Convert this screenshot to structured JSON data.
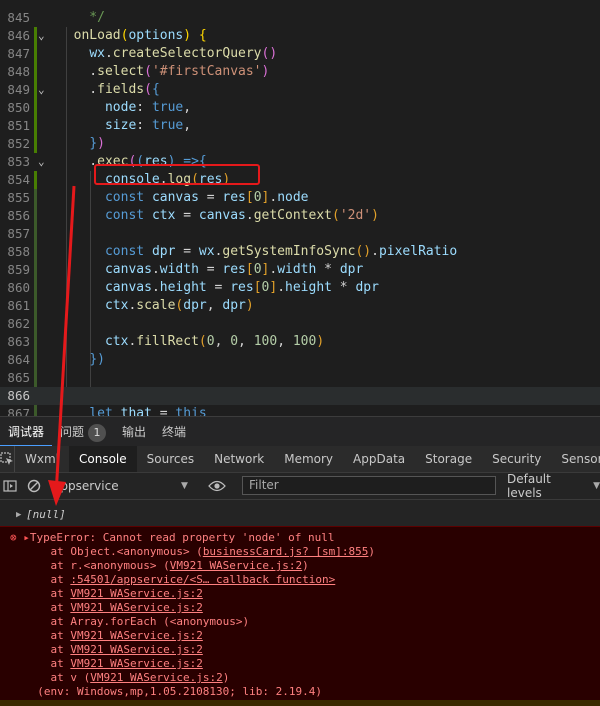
{
  "editor": {
    "lines": [
      {
        "num": "845",
        "segs": [
          {
            "t": "    */",
            "c": "c"
          }
        ]
      },
      {
        "num": "846",
        "fold": true,
        "segs": [
          {
            "t": "  ",
            "c": "pl"
          },
          {
            "t": "onLoad",
            "c": "f"
          },
          {
            "t": "(",
            "c": "y"
          },
          {
            "t": "options",
            "c": "p"
          },
          {
            "t": ") ",
            "c": "y"
          },
          {
            "t": "{",
            "c": "y"
          }
        ]
      },
      {
        "num": "847",
        "segs": [
          {
            "t": "    ",
            "c": "pl"
          },
          {
            "t": "wx",
            "c": "p"
          },
          {
            "t": ".",
            "c": "pl"
          },
          {
            "t": "createSelectorQuery",
            "c": "f"
          },
          {
            "t": "()",
            "c": "pu"
          }
        ]
      },
      {
        "num": "848",
        "segs": [
          {
            "t": "    .",
            "c": "pl"
          },
          {
            "t": "select",
            "c": "f"
          },
          {
            "t": "(",
            "c": "pu"
          },
          {
            "t": "'#firstCanvas'",
            "c": "s"
          },
          {
            "t": ")",
            "c": "pu"
          }
        ]
      },
      {
        "num": "849",
        "fold": true,
        "segs": [
          {
            "t": "    .",
            "c": "pl"
          },
          {
            "t": "fields",
            "c": "f"
          },
          {
            "t": "(",
            "c": "pu"
          },
          {
            "t": "{",
            "c": "v"
          }
        ]
      },
      {
        "num": "850",
        "segs": [
          {
            "t": "      ",
            "c": "pl"
          },
          {
            "t": "node",
            "c": "p"
          },
          {
            "t": ": ",
            "c": "pl"
          },
          {
            "t": "true",
            "c": "v"
          },
          {
            "t": ",",
            "c": "pl"
          }
        ]
      },
      {
        "num": "851",
        "segs": [
          {
            "t": "      ",
            "c": "pl"
          },
          {
            "t": "size",
            "c": "p"
          },
          {
            "t": ": ",
            "c": "pl"
          },
          {
            "t": "true",
            "c": "v"
          },
          {
            "t": ",",
            "c": "pl"
          }
        ]
      },
      {
        "num": "852",
        "segs": [
          {
            "t": "    ",
            "c": "pl"
          },
          {
            "t": "}",
            "c": "v"
          },
          {
            "t": ")",
            "c": "pu"
          }
        ]
      },
      {
        "num": "853",
        "fold": true,
        "segs": [
          {
            "t": "    .",
            "c": "pl"
          },
          {
            "t": "exec",
            "c": "f"
          },
          {
            "t": "(",
            "c": "pu"
          },
          {
            "t": "(",
            "c": "v"
          },
          {
            "t": "res",
            "c": "p"
          },
          {
            "t": ")",
            "c": "v"
          },
          {
            "t": " ",
            "c": "pl"
          },
          {
            "t": "=>",
            "c": "v"
          },
          {
            "t": "{",
            "c": "v"
          }
        ]
      },
      {
        "num": "854",
        "segs": [
          {
            "t": "      ",
            "c": "pl"
          },
          {
            "t": "console",
            "c": "p"
          },
          {
            "t": ".",
            "c": "pl"
          },
          {
            "t": "log",
            "c": "f"
          },
          {
            "t": "(",
            "c": "o"
          },
          {
            "t": "res",
            "c": "p"
          },
          {
            "t": ")",
            "c": "o"
          }
        ]
      },
      {
        "num": "855",
        "segs": [
          {
            "t": "      ",
            "c": "pl"
          },
          {
            "t": "const",
            "c": "v"
          },
          {
            "t": " ",
            "c": "pl"
          },
          {
            "t": "canvas",
            "c": "p"
          },
          {
            "t": " = ",
            "c": "pl"
          },
          {
            "t": "res",
            "c": "p"
          },
          {
            "t": "[",
            "c": "o"
          },
          {
            "t": "0",
            "c": "n"
          },
          {
            "t": "]",
            "c": "o"
          },
          {
            "t": ".",
            "c": "pl"
          },
          {
            "t": "node",
            "c": "p"
          }
        ]
      },
      {
        "num": "856",
        "segs": [
          {
            "t": "      ",
            "c": "pl"
          },
          {
            "t": "const",
            "c": "v"
          },
          {
            "t": " ",
            "c": "pl"
          },
          {
            "t": "ctx",
            "c": "p"
          },
          {
            "t": " = ",
            "c": "pl"
          },
          {
            "t": "canvas",
            "c": "p"
          },
          {
            "t": ".",
            "c": "pl"
          },
          {
            "t": "getContext",
            "c": "f"
          },
          {
            "t": "(",
            "c": "o"
          },
          {
            "t": "'2d'",
            "c": "s"
          },
          {
            "t": ")",
            "c": "o"
          }
        ]
      },
      {
        "num": "857",
        "segs": []
      },
      {
        "num": "858",
        "segs": [
          {
            "t": "      ",
            "c": "pl"
          },
          {
            "t": "const",
            "c": "v"
          },
          {
            "t": " ",
            "c": "pl"
          },
          {
            "t": "dpr",
            "c": "p"
          },
          {
            "t": " = ",
            "c": "pl"
          },
          {
            "t": "wx",
            "c": "p"
          },
          {
            "t": ".",
            "c": "pl"
          },
          {
            "t": "getSystemInfoSync",
            "c": "f"
          },
          {
            "t": "()",
            "c": "o"
          },
          {
            "t": ".",
            "c": "pl"
          },
          {
            "t": "pixelRatio",
            "c": "p"
          }
        ]
      },
      {
        "num": "859",
        "segs": [
          {
            "t": "      ",
            "c": "pl"
          },
          {
            "t": "canvas",
            "c": "p"
          },
          {
            "t": ".",
            "c": "pl"
          },
          {
            "t": "width",
            "c": "p"
          },
          {
            "t": " = ",
            "c": "pl"
          },
          {
            "t": "res",
            "c": "p"
          },
          {
            "t": "[",
            "c": "o"
          },
          {
            "t": "0",
            "c": "n"
          },
          {
            "t": "]",
            "c": "o"
          },
          {
            "t": ".",
            "c": "pl"
          },
          {
            "t": "width",
            "c": "p"
          },
          {
            "t": " * ",
            "c": "pl"
          },
          {
            "t": "dpr",
            "c": "p"
          }
        ]
      },
      {
        "num": "860",
        "segs": [
          {
            "t": "      ",
            "c": "pl"
          },
          {
            "t": "canvas",
            "c": "p"
          },
          {
            "t": ".",
            "c": "pl"
          },
          {
            "t": "height",
            "c": "p"
          },
          {
            "t": " = ",
            "c": "pl"
          },
          {
            "t": "res",
            "c": "p"
          },
          {
            "t": "[",
            "c": "o"
          },
          {
            "t": "0",
            "c": "n"
          },
          {
            "t": "]",
            "c": "o"
          },
          {
            "t": ".",
            "c": "pl"
          },
          {
            "t": "height",
            "c": "p"
          },
          {
            "t": " * ",
            "c": "pl"
          },
          {
            "t": "dpr",
            "c": "p"
          }
        ]
      },
      {
        "num": "861",
        "segs": [
          {
            "t": "      ",
            "c": "pl"
          },
          {
            "t": "ctx",
            "c": "p"
          },
          {
            "t": ".",
            "c": "pl"
          },
          {
            "t": "scale",
            "c": "f"
          },
          {
            "t": "(",
            "c": "o"
          },
          {
            "t": "dpr",
            "c": "p"
          },
          {
            "t": ", ",
            "c": "pl"
          },
          {
            "t": "dpr",
            "c": "p"
          },
          {
            "t": ")",
            "c": "o"
          }
        ]
      },
      {
        "num": "862",
        "segs": []
      },
      {
        "num": "863",
        "segs": [
          {
            "t": "      ",
            "c": "pl"
          },
          {
            "t": "ctx",
            "c": "p"
          },
          {
            "t": ".",
            "c": "pl"
          },
          {
            "t": "fillRect",
            "c": "f"
          },
          {
            "t": "(",
            "c": "o"
          },
          {
            "t": "0",
            "c": "n"
          },
          {
            "t": ", ",
            "c": "pl"
          },
          {
            "t": "0",
            "c": "n"
          },
          {
            "t": ", ",
            "c": "pl"
          },
          {
            "t": "100",
            "c": "n"
          },
          {
            "t": ", ",
            "c": "pl"
          },
          {
            "t": "100",
            "c": "n"
          },
          {
            "t": ")",
            "c": "o"
          }
        ]
      },
      {
        "num": "864",
        "segs": [
          {
            "t": "    ",
            "c": "pl"
          },
          {
            "t": "})",
            "c": "v"
          }
        ]
      },
      {
        "num": "865",
        "segs": []
      },
      {
        "num": "866",
        "current": true,
        "segs": []
      },
      {
        "num": "867",
        "segs": [
          {
            "t": "    ",
            "c": "pl"
          },
          {
            "t": "let",
            "c": "v"
          },
          {
            "t": " ",
            "c": "pl"
          },
          {
            "t": "that",
            "c": "p"
          },
          {
            "t": " = ",
            "c": "pl"
          },
          {
            "t": "this",
            "c": "v"
          }
        ]
      }
    ]
  },
  "panel_tabs": {
    "debugger": "调试器",
    "issues": "问题",
    "issues_count": "1",
    "output": "输出",
    "terminal": "终端"
  },
  "devtools_tabs": [
    "Wxml",
    "Console",
    "Sources",
    "Network",
    "Memory",
    "AppData",
    "Storage",
    "Security",
    "Sensor"
  ],
  "devtools_active": "Console",
  "toolbar": {
    "context": "appservice",
    "filter_placeholder": "Filter",
    "levels": "Default levels"
  },
  "console": {
    "null_log": "[null]",
    "error_lines": [
      {
        "t": "TypeError: Cannot read property 'node' of null",
        "icon": true
      },
      {
        "t": "    at Object.<anonymous> (",
        "link": "businessCard.js? [sm]:855",
        "tail": ")"
      },
      {
        "t": "    at r.<anonymous> (",
        "link": "VM921 WAService.js:2",
        "tail": ")"
      },
      {
        "t": "    at ",
        "link": ":54501/appservice/<S… callback function>",
        "tail": ""
      },
      {
        "t": "    at ",
        "link": "VM921 WAService.js:2",
        "tail": ""
      },
      {
        "t": "    at ",
        "link": "VM921 WAService.js:2",
        "tail": ""
      },
      {
        "t": "    at Array.forEach (<anonymous>)",
        "link": "",
        "tail": ""
      },
      {
        "t": "    at ",
        "link": "VM921 WAService.js:2",
        "tail": ""
      },
      {
        "t": "    at ",
        "link": "VM921 WAService.js:2",
        "tail": ""
      },
      {
        "t": "    at ",
        "link": "VM921 WAService.js:2",
        "tail": ""
      },
      {
        "t": "    at v (",
        "link": "VM921 WAService.js:2",
        "tail": ")"
      },
      {
        "t": "  (env: Windows,mp,1.05.2108130; lib: 2.19.4)",
        "link": "",
        "tail": ""
      }
    ]
  },
  "colors": {
    "highlight_box": "#e5191b",
    "arrow": "#e5191b",
    "error_bg": "#290000",
    "error_text": "#ff8080"
  }
}
